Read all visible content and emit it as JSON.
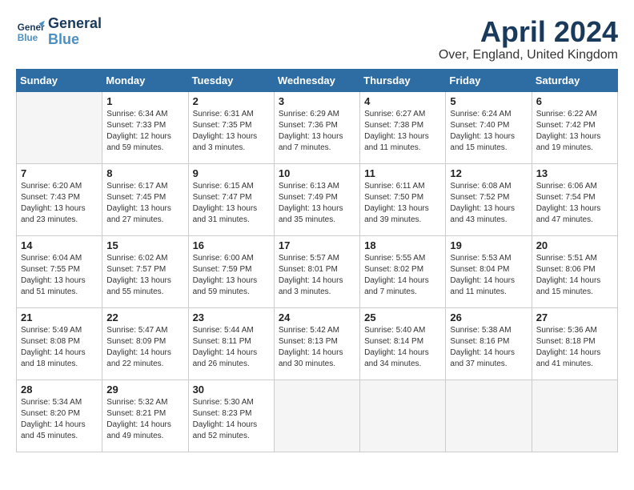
{
  "header": {
    "logo_line1": "General",
    "logo_line2": "Blue",
    "month_year": "April 2024",
    "location": "Over, England, United Kingdom"
  },
  "days_of_week": [
    "Sunday",
    "Monday",
    "Tuesday",
    "Wednesday",
    "Thursday",
    "Friday",
    "Saturday"
  ],
  "weeks": [
    [
      {
        "day": "",
        "empty": true
      },
      {
        "day": "1",
        "sunrise": "6:34 AM",
        "sunset": "7:33 PM",
        "daylight": "12 hours and 59 minutes."
      },
      {
        "day": "2",
        "sunrise": "6:31 AM",
        "sunset": "7:35 PM",
        "daylight": "13 hours and 3 minutes."
      },
      {
        "day": "3",
        "sunrise": "6:29 AM",
        "sunset": "7:36 PM",
        "daylight": "13 hours and 7 minutes."
      },
      {
        "day": "4",
        "sunrise": "6:27 AM",
        "sunset": "7:38 PM",
        "daylight": "13 hours and 11 minutes."
      },
      {
        "day": "5",
        "sunrise": "6:24 AM",
        "sunset": "7:40 PM",
        "daylight": "13 hours and 15 minutes."
      },
      {
        "day": "6",
        "sunrise": "6:22 AM",
        "sunset": "7:42 PM",
        "daylight": "13 hours and 19 minutes."
      }
    ],
    [
      {
        "day": "7",
        "sunrise": "6:20 AM",
        "sunset": "7:43 PM",
        "daylight": "13 hours and 23 minutes."
      },
      {
        "day": "8",
        "sunrise": "6:17 AM",
        "sunset": "7:45 PM",
        "daylight": "13 hours and 27 minutes."
      },
      {
        "day": "9",
        "sunrise": "6:15 AM",
        "sunset": "7:47 PM",
        "daylight": "13 hours and 31 minutes."
      },
      {
        "day": "10",
        "sunrise": "6:13 AM",
        "sunset": "7:49 PM",
        "daylight": "13 hours and 35 minutes."
      },
      {
        "day": "11",
        "sunrise": "6:11 AM",
        "sunset": "7:50 PM",
        "daylight": "13 hours and 39 minutes."
      },
      {
        "day": "12",
        "sunrise": "6:08 AM",
        "sunset": "7:52 PM",
        "daylight": "13 hours and 43 minutes."
      },
      {
        "day": "13",
        "sunrise": "6:06 AM",
        "sunset": "7:54 PM",
        "daylight": "13 hours and 47 minutes."
      }
    ],
    [
      {
        "day": "14",
        "sunrise": "6:04 AM",
        "sunset": "7:55 PM",
        "daylight": "13 hours and 51 minutes."
      },
      {
        "day": "15",
        "sunrise": "6:02 AM",
        "sunset": "7:57 PM",
        "daylight": "13 hours and 55 minutes."
      },
      {
        "day": "16",
        "sunrise": "6:00 AM",
        "sunset": "7:59 PM",
        "daylight": "13 hours and 59 minutes."
      },
      {
        "day": "17",
        "sunrise": "5:57 AM",
        "sunset": "8:01 PM",
        "daylight": "14 hours and 3 minutes."
      },
      {
        "day": "18",
        "sunrise": "5:55 AM",
        "sunset": "8:02 PM",
        "daylight": "14 hours and 7 minutes."
      },
      {
        "day": "19",
        "sunrise": "5:53 AM",
        "sunset": "8:04 PM",
        "daylight": "14 hours and 11 minutes."
      },
      {
        "day": "20",
        "sunrise": "5:51 AM",
        "sunset": "8:06 PM",
        "daylight": "14 hours and 15 minutes."
      }
    ],
    [
      {
        "day": "21",
        "sunrise": "5:49 AM",
        "sunset": "8:08 PM",
        "daylight": "14 hours and 18 minutes."
      },
      {
        "day": "22",
        "sunrise": "5:47 AM",
        "sunset": "8:09 PM",
        "daylight": "14 hours and 22 minutes."
      },
      {
        "day": "23",
        "sunrise": "5:44 AM",
        "sunset": "8:11 PM",
        "daylight": "14 hours and 26 minutes."
      },
      {
        "day": "24",
        "sunrise": "5:42 AM",
        "sunset": "8:13 PM",
        "daylight": "14 hours and 30 minutes."
      },
      {
        "day": "25",
        "sunrise": "5:40 AM",
        "sunset": "8:14 PM",
        "daylight": "14 hours and 34 minutes."
      },
      {
        "day": "26",
        "sunrise": "5:38 AM",
        "sunset": "8:16 PM",
        "daylight": "14 hours and 37 minutes."
      },
      {
        "day": "27",
        "sunrise": "5:36 AM",
        "sunset": "8:18 PM",
        "daylight": "14 hours and 41 minutes."
      }
    ],
    [
      {
        "day": "28",
        "sunrise": "5:34 AM",
        "sunset": "8:20 PM",
        "daylight": "14 hours and 45 minutes."
      },
      {
        "day": "29",
        "sunrise": "5:32 AM",
        "sunset": "8:21 PM",
        "daylight": "14 hours and 49 minutes."
      },
      {
        "day": "30",
        "sunrise": "5:30 AM",
        "sunset": "8:23 PM",
        "daylight": "14 hours and 52 minutes."
      },
      {
        "day": "",
        "empty": true
      },
      {
        "day": "",
        "empty": true
      },
      {
        "day": "",
        "empty": true
      },
      {
        "day": "",
        "empty": true
      }
    ]
  ],
  "labels": {
    "sunrise_prefix": "Sunrise: ",
    "sunset_prefix": "Sunset: ",
    "daylight_prefix": "Daylight: "
  }
}
